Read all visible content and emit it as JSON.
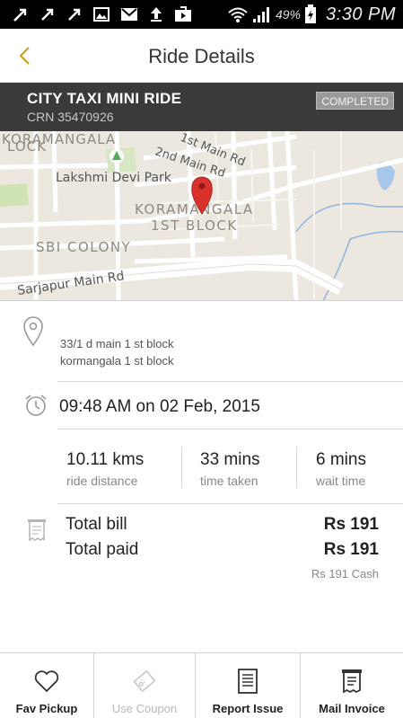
{
  "status_bar": {
    "battery_percent": "49%",
    "time": "3:30 PM",
    "icons": [
      "missed-call-icon",
      "missed-call-icon",
      "missed-call-icon",
      "image-icon",
      "gmail-icon",
      "upload-icon",
      "play-store-icon",
      "wifi-icon",
      "signal-icon",
      "battery-charging-icon"
    ]
  },
  "app_bar": {
    "title": "Ride Details",
    "back_icon": "chevron-left-icon",
    "accent_color": "#c9a21b"
  },
  "ride": {
    "name": "CITY TAXI MINI RIDE",
    "crn": "CRN 35470926",
    "status": "COMPLETED"
  },
  "map": {
    "labels": {
      "area_top_left": "KORAMANGALA",
      "area_top_left_2": "LOCK",
      "road_2nd_main": "2nd Main Rd",
      "road_1st_main": "1st Main Rd",
      "park": "Lakshmi Devi Park",
      "area_line1": "KORAMANGALA",
      "area_line2": "1ST BLOCK",
      "colony": "SBI COLONY",
      "road_sarjapur": "Sarjapur Main Rd"
    },
    "pin_color": "#d9312b"
  },
  "pickup": {
    "address_line1": "33/1 d main 1 st block",
    "address_line2": "kormangala 1 st block"
  },
  "datetime": "09:48 AM on 02 Feb, 2015",
  "stats": [
    {
      "value": "10.11 kms",
      "label": "ride distance"
    },
    {
      "value": "33 mins",
      "label": "time taken"
    },
    {
      "value": "6 mins",
      "label": "wait time"
    }
  ],
  "bill": {
    "total_bill_label": "Total bill",
    "total_bill_amount": "Rs 191",
    "total_paid_label": "Total paid",
    "total_paid_amount": "Rs 191",
    "payment_mode": "Rs 191 Cash"
  },
  "bottom_actions": [
    {
      "label": "Fav Pickup",
      "icon": "heart-icon",
      "enabled": true
    },
    {
      "label": "Use Coupon",
      "icon": "coupon-icon",
      "enabled": false
    },
    {
      "label": "Report Issue",
      "icon": "document-icon",
      "enabled": true
    },
    {
      "label": "Mail Invoice",
      "icon": "receipt-icon",
      "enabled": true
    }
  ]
}
